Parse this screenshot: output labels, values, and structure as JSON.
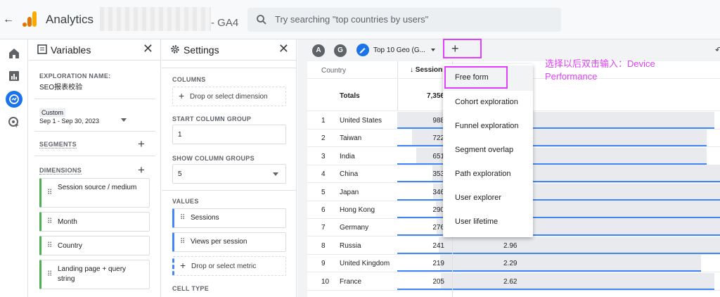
{
  "topbar": {
    "app_title": "Analytics",
    "account_suffix": "- GA4",
    "search_placeholder": "Try searching \"top countries by users\""
  },
  "variables_panel": {
    "title": "Variables",
    "exploration_name_label": "EXPLORATION NAME:",
    "exploration_name": "SEO报表校验",
    "date_preset": "Custom",
    "date_range": "Sep 1 - Sep 30, 2023",
    "segments_label": "SEGMENTS",
    "dimensions_label": "DIMENSIONS",
    "dimensions": [
      "Session source / medium",
      "Month",
      "Country",
      "Landing page + query string"
    ]
  },
  "settings_panel": {
    "title": "Settings",
    "columns_label": "COLUMNS",
    "drop_dimension": "Drop or select dimension",
    "start_column_group_label": "START COLUMN GROUP",
    "start_column_group_value": "1",
    "show_column_groups_label": "SHOW COLUMN GROUPS",
    "show_column_groups_value": "5",
    "values_label": "VALUES",
    "values": [
      "Sessions",
      "Views per session"
    ],
    "drop_metric": "Drop or select metric",
    "cell_type_label": "CELL TYPE"
  },
  "canvas": {
    "avatars": [
      "A",
      "G"
    ],
    "tab_label": "Top 10 Geo (G...",
    "table": {
      "col_country": "Country",
      "col_sessions": "↓ Sessions",
      "totals_label": "Totals",
      "totals_sessions": "7,356",
      "rows": [
        {
          "rank": "1",
          "country": "United States",
          "sessions": "988",
          "vps": ""
        },
        {
          "rank": "2",
          "country": "Taiwan",
          "sessions": "722",
          "vps": ""
        },
        {
          "rank": "3",
          "country": "India",
          "sessions": "651",
          "vps": ""
        },
        {
          "rank": "4",
          "country": "China",
          "sessions": "353",
          "vps": ""
        },
        {
          "rank": "5",
          "country": "Japan",
          "sessions": "346",
          "vps": ""
        },
        {
          "rank": "6",
          "country": "Hong Kong",
          "sessions": "290",
          "vps": ""
        },
        {
          "rank": "7",
          "country": "Germany",
          "sessions": "276",
          "vps": ""
        },
        {
          "rank": "8",
          "country": "Russia",
          "sessions": "241",
          "vps": "2.96"
        },
        {
          "rank": "9",
          "country": "United Kingdom",
          "sessions": "219",
          "vps": "2.29"
        },
        {
          "rank": "10",
          "country": "France",
          "sessions": "205",
          "vps": "2.62"
        }
      ],
      "vps_bar_levels": [
        0.98,
        0.95,
        0.95,
        1.0,
        1.0,
        1.0,
        1.0,
        1.0,
        0.93,
        0.98
      ]
    }
  },
  "menu": {
    "items": [
      "Free form",
      "Cohort exploration",
      "Funnel exploration",
      "Segment overlap",
      "Path exploration",
      "User explorer",
      "User lifetime"
    ]
  },
  "annotation": "选择以后双击输入：Device Performance",
  "colors": {
    "accent": "#1a73e8",
    "highlight": "#e040fb",
    "dimension_chip": "#4caf50",
    "metric_chip": "#4285f4"
  }
}
